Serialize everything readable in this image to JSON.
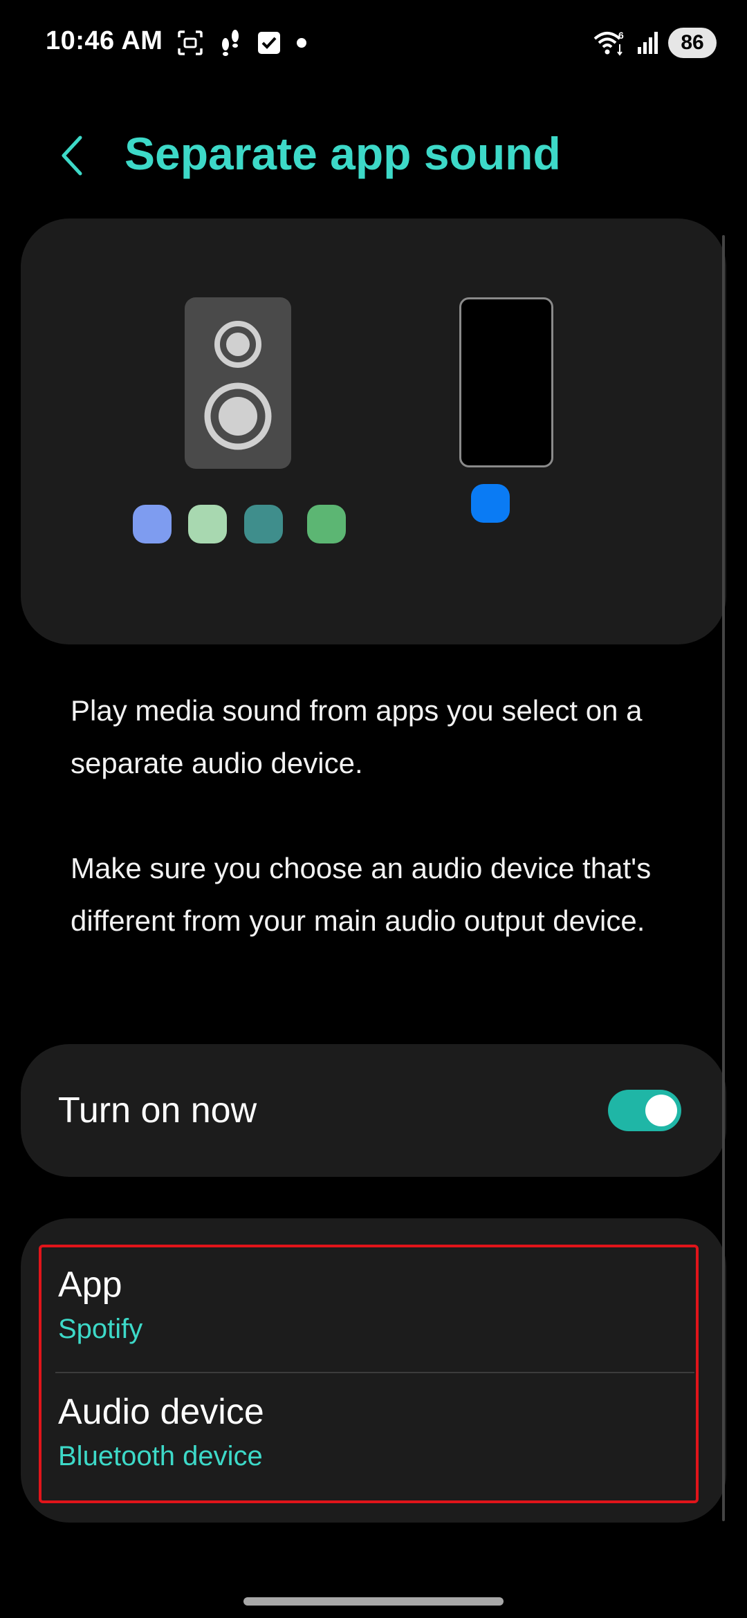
{
  "status_bar": {
    "time": "10:46 AM",
    "battery_level": "86",
    "icons_left": [
      "screen-capture-icon",
      "footsteps-icon",
      "checkbox-icon",
      "dot-icon"
    ],
    "icons_right": [
      "wifi-icon",
      "signal-icon"
    ],
    "wifi_badge": "6"
  },
  "header": {
    "back_icon": "chevron-left-icon",
    "title": "Separate app sound"
  },
  "illustration": {
    "speaker_color": "#4a4a4a",
    "phone_color": "#000000",
    "speaker_app_colors": [
      "#7e9cf0",
      "#a8d8b0",
      "#3f8e8c",
      "#5cb673"
    ],
    "phone_app_color": "#0a7bf4"
  },
  "description": {
    "paragraph1": "Play media sound from apps you select on a separate audio device.",
    "paragraph2": "Make sure you choose an audio device that's different from your main audio output device."
  },
  "toggle": {
    "label": "Turn on now",
    "state": "on"
  },
  "settings": {
    "app": {
      "title": "App",
      "value": "Spotify"
    },
    "audio_device": {
      "title": "Audio device",
      "value": "Bluetooth device"
    }
  },
  "colors": {
    "accent": "#3dd9c8",
    "switch_on": "#1fb6a6",
    "highlight": "#e0141a",
    "card": "#1c1c1c",
    "background": "#000000"
  }
}
